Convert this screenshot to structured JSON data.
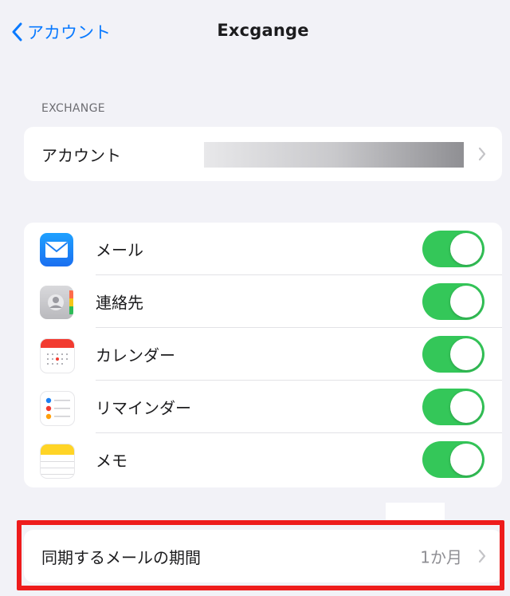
{
  "navbar": {
    "back_label": "アカウント",
    "title": "Excgange"
  },
  "exchange_section": {
    "header": "EXCHANGE",
    "account_row": {
      "label": "アカウント",
      "value_redacted": true
    }
  },
  "apps": [
    {
      "label": "メール",
      "icon": "mail-icon",
      "enabled": true
    },
    {
      "label": "連絡先",
      "icon": "contacts-icon",
      "enabled": true
    },
    {
      "label": "カレンダー",
      "icon": "calendar-icon",
      "enabled": true
    },
    {
      "label": "リマインダー",
      "icon": "reminders-icon",
      "enabled": true
    },
    {
      "label": "メモ",
      "icon": "notes-icon",
      "enabled": true
    }
  ],
  "sync": {
    "label": "同期するメールの期間",
    "value": "1か月",
    "highlighted": true
  },
  "colors": {
    "accent": "#0a7aff",
    "toggle_on": "#34c759",
    "highlight": "#ee1c1c",
    "background": "#f2f2f7"
  }
}
